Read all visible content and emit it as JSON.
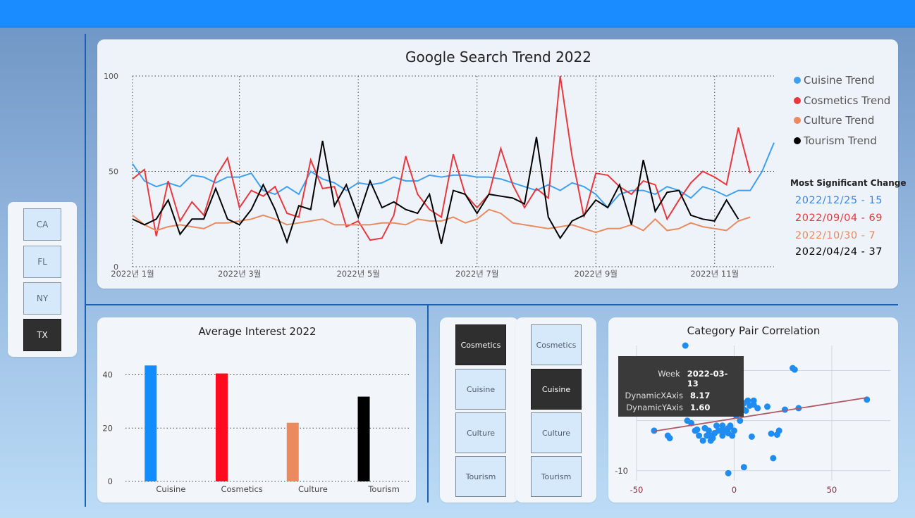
{
  "state_slicer": {
    "options": [
      {
        "label": "CA",
        "selected": false
      },
      {
        "label": "FL",
        "selected": false
      },
      {
        "label": "NY",
        "selected": false
      },
      {
        "label": "TX",
        "selected": true
      }
    ]
  },
  "trend": {
    "title": "Google Search Trend 2022",
    "legend": [
      {
        "label": "Cuisine Trend",
        "color": "#3fa0f0"
      },
      {
        "label": "Cosmetics Trend",
        "color": "#e8383d"
      },
      {
        "label": "Culture Trend",
        "color": "#ea8a5f"
      },
      {
        "label": "Tourism Trend",
        "color": "#000000"
      }
    ],
    "msc_title": "Most Significant Change",
    "msc": [
      {
        "text": "2022/12/25 - 15",
        "color": "#3a86df"
      },
      {
        "text": "2022/09/04 - 69",
        "color": "#e8383d"
      },
      {
        "text": "2022/10/30 - 7",
        "color": "#ea8a5f"
      },
      {
        "text": "2022/04/24 - 37",
        "color": "#000000"
      }
    ]
  },
  "avg": {
    "title": "Average Interest 2022"
  },
  "pair_slicers": {
    "left": [
      {
        "label": "Cosmetics",
        "selected": true
      },
      {
        "label": "Cuisine",
        "selected": false
      },
      {
        "label": "Culture",
        "selected": false
      },
      {
        "label": "Tourism",
        "selected": false
      }
    ],
    "right": [
      {
        "label": "Cosmetics",
        "selected": false
      },
      {
        "label": "Cuisine",
        "selected": true
      },
      {
        "label": "Culture",
        "selected": false
      },
      {
        "label": "Tourism",
        "selected": false
      }
    ]
  },
  "correlation": {
    "title": "Category Pair Correlation",
    "tooltip": [
      {
        "label": "Week",
        "value": "2022-03-13"
      },
      {
        "label": "DynamicXAxis",
        "value": "8.17"
      },
      {
        "label": "DynamicYAxis",
        "value": "1.60"
      }
    ]
  },
  "chart_data": [
    {
      "type": "line",
      "title": "Google Search Trend 2022",
      "xlabel": "",
      "ylabel": "",
      "x_ticks": [
        "2022년 1월",
        "2022년 3월",
        "2022년 5월",
        "2022년 7월",
        "2022년 9월",
        "2022년 11월"
      ],
      "x_tick_index": [
        0,
        9,
        19,
        29,
        39,
        49
      ],
      "ylim": [
        0,
        100
      ],
      "y_ticks": [
        0,
        50,
        100
      ],
      "grid": true,
      "legend_position": "right",
      "series": [
        {
          "name": "Cuisine Trend",
          "color": "#3fa0f0",
          "values": [
            54,
            45,
            42,
            44,
            42,
            48,
            47,
            44,
            47,
            47,
            49,
            40,
            38,
            42,
            38,
            50,
            46,
            44,
            40,
            44,
            43,
            44,
            47,
            45,
            45,
            48,
            47,
            48,
            48,
            47,
            47,
            46,
            44,
            42,
            40,
            43,
            40,
            44,
            42,
            38,
            31,
            38,
            40,
            40,
            38,
            42,
            40,
            36,
            42,
            40,
            37,
            40,
            40,
            50,
            65
          ]
        },
        {
          "name": "Cosmetics Trend",
          "color": "#e8383d",
          "values": [
            46,
            51,
            16,
            45,
            24,
            34,
            27,
            47,
            57,
            31,
            40,
            37,
            42,
            28,
            26,
            56,
            41,
            42,
            21,
            24,
            14,
            15,
            27,
            58,
            38,
            30,
            26,
            59,
            38,
            31,
            38,
            62,
            43,
            31,
            41,
            36,
            100,
            58,
            26,
            49,
            48,
            42,
            38,
            45,
            43,
            25,
            35,
            44,
            50,
            47,
            43,
            73,
            49
          ]
        },
        {
          "name": "Culture Trend",
          "color": "#ea8a5f",
          "values": [
            27,
            22,
            19,
            21,
            22,
            21,
            20,
            23,
            23,
            24,
            25,
            27,
            25,
            22,
            23,
            24,
            25,
            22,
            22,
            22,
            22,
            23,
            23,
            22,
            25,
            24,
            24,
            26,
            23,
            25,
            30,
            28,
            23,
            22,
            21,
            20,
            21,
            22,
            20,
            18,
            20,
            20,
            22,
            19,
            25,
            19,
            20,
            23,
            21,
            20,
            19,
            24,
            26
          ]
        },
        {
          "name": "Tourism Trend",
          "color": "#000000",
          "values": [
            25,
            22,
            25,
            35,
            17,
            25,
            25,
            41,
            25,
            22,
            30,
            43,
            30,
            13,
            32,
            30,
            66,
            32,
            43,
            26,
            45,
            31,
            34,
            30,
            28,
            38,
            12,
            40,
            38,
            28,
            38,
            37,
            36,
            33,
            68,
            26,
            15,
            24,
            27,
            35,
            31,
            43,
            22,
            56,
            29,
            39,
            40,
            27,
            25,
            24,
            35,
            25
          ]
        }
      ]
    },
    {
      "type": "bar",
      "title": "Average Interest 2022",
      "categories": [
        "Cuisine",
        "Cosmetics",
        "Culture",
        "Tourism"
      ],
      "values": [
        43.5,
        40.5,
        22.0,
        31.8
      ],
      "colors": [
        "#118dff",
        "#ff0a1e",
        "#eb895f",
        "#000000"
      ],
      "ylim": [
        0,
        47
      ],
      "y_ticks": [
        0,
        20,
        40
      ],
      "grid": true
    },
    {
      "type": "scatter",
      "title": "Category Pair Correlation",
      "xlim": [
        -50,
        80
      ],
      "ylim": [
        -12,
        15
      ],
      "x_ticks": [
        -50,
        0,
        50
      ],
      "y_ticks": [
        -10
      ],
      "x": [
        -25,
        -41,
        -34,
        -33,
        -18,
        -16,
        -13,
        -12,
        -11,
        -8,
        -6,
        -4,
        -3,
        -2,
        0,
        1,
        3,
        4,
        5,
        6,
        7,
        8,
        10,
        10,
        12,
        -20,
        -15,
        -14,
        -10,
        -9,
        -5,
        -3,
        -1,
        -6,
        -12,
        -7,
        -19,
        -22,
        -2,
        2,
        5,
        -10,
        9,
        17,
        19,
        22,
        20,
        26,
        30,
        31,
        33,
        68,
        23,
        -3,
        5,
        -24
      ],
      "y": [
        15,
        -2,
        -3,
        -3.5,
        -3,
        -4,
        -2,
        -3,
        -3.5,
        -2,
        -3,
        -2,
        -1.5,
        -1,
        -2,
        1,
        0,
        3,
        3.5,
        2,
        4,
        3,
        4,
        3.2,
        2.5,
        -2,
        -1.5,
        -3,
        -2.5,
        -1,
        -2,
        -2.5,
        -3,
        -1,
        -4,
        -2,
        -1.8,
        -0.5,
        -1.2,
        1.6,
        2.2,
        -2.5,
        -3.2,
        2.8,
        -2.6,
        -2.8,
        -7.5,
        2.2,
        10.5,
        10.2,
        2.5,
        4.2,
        -2,
        -10.5,
        -9.3,
        0
      ],
      "trend_line": {
        "x": [
          -41,
          68
        ],
        "y": [
          -2.1,
          4.6
        ]
      }
    }
  ]
}
